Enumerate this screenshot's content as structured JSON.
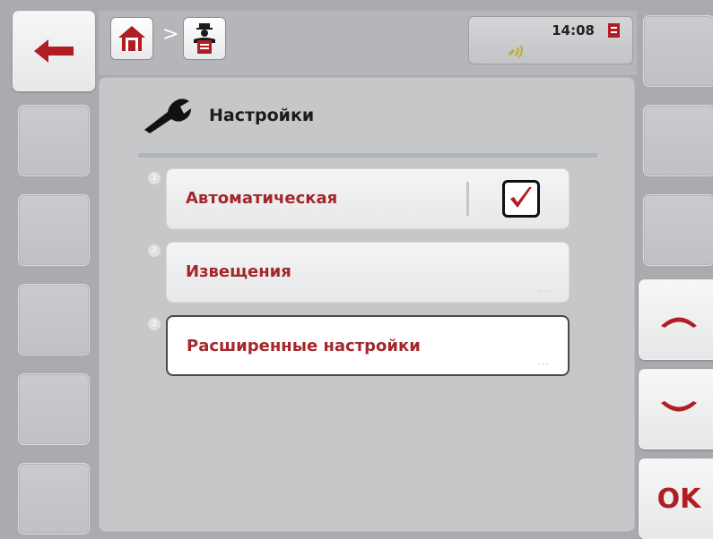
{
  "status": {
    "time": "14:08"
  },
  "main": {
    "title": "Настройки",
    "items": [
      {
        "number": "1",
        "label": "Автоматическая",
        "checked": true
      },
      {
        "number": "2",
        "label": "Извещения",
        "more": "..."
      },
      {
        "number": "3",
        "label": "Расширенные настройки",
        "more": "...",
        "selected": true
      }
    ]
  },
  "softkeys": {
    "ok_label": "OK"
  },
  "colors": {
    "accent": "#a2282c",
    "brand_red": "#b01e24"
  }
}
